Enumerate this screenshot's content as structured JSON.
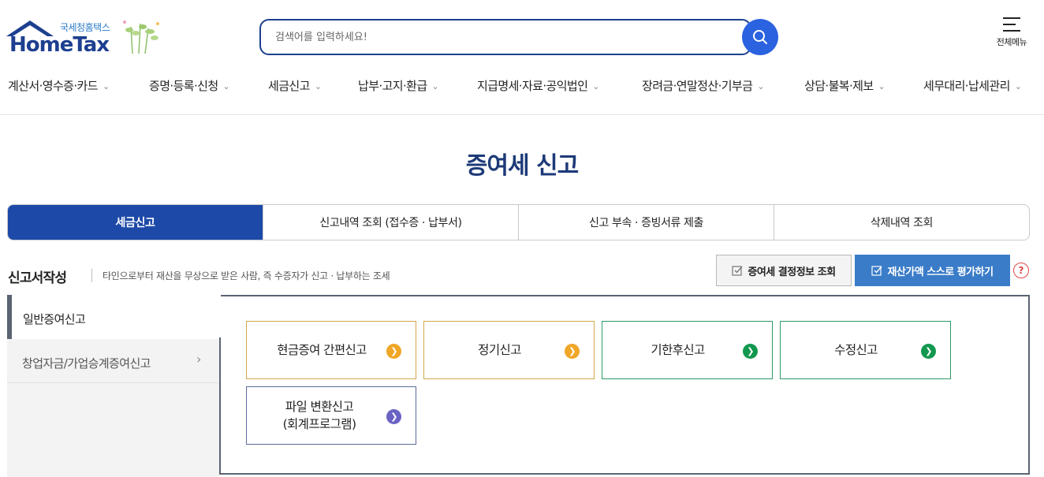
{
  "header": {
    "logo_kr": "국세청홈택스",
    "logo_en": "HomeTax",
    "search_placeholder": "검색어를 입력하세요!",
    "all_menu_label": "전체메뉴"
  },
  "gnb": [
    "계산서·영수증·카드",
    "증명·등록·신청",
    "세금신고",
    "납부·고지·환급",
    "지급명세·자료·공익법인",
    "장려금·연말정산·기부금",
    "상담·불복·제보",
    "세무대리·납세관리"
  ],
  "page_title": "증여세 신고",
  "tabs": [
    {
      "label": "세금신고",
      "active": true
    },
    {
      "label": "신고내역 조회 (접수증 · 납부서)",
      "active": false
    },
    {
      "label": "신고 부속 · 증빙서류 제출",
      "active": false
    },
    {
      "label": "삭제내역 조회",
      "active": false
    }
  ],
  "section": {
    "title": "신고서작성",
    "description": "타인으로부터 재산을 무상으로 받은 사람, 즉 수증자가 신고 · 납부하는 조세"
  },
  "buttons": {
    "info": "증여세 결정정보 조회",
    "eval": "재산가액 스스로 평가하기",
    "help": "?"
  },
  "sidebar": [
    {
      "label": "일반증여신고",
      "active": true
    },
    {
      "label": "창업자금/가업승계증여신고",
      "active": false
    }
  ],
  "cards": [
    {
      "label": "현금증여 간편신고",
      "color": "#f0a627"
    },
    {
      "label": "정기신고",
      "color": "#f0a627"
    },
    {
      "label": "기한후신고",
      "color": "#12984f"
    },
    {
      "label": "수정신고",
      "color": "#12984f"
    },
    {
      "label_line1": "파일 변환신고",
      "label_line2": "(회계프로그램)",
      "color": "#6a63c4"
    }
  ],
  "icons": {
    "chevron": "chevron-down-icon",
    "card_arrow": "chevron-right-circle-icon"
  }
}
